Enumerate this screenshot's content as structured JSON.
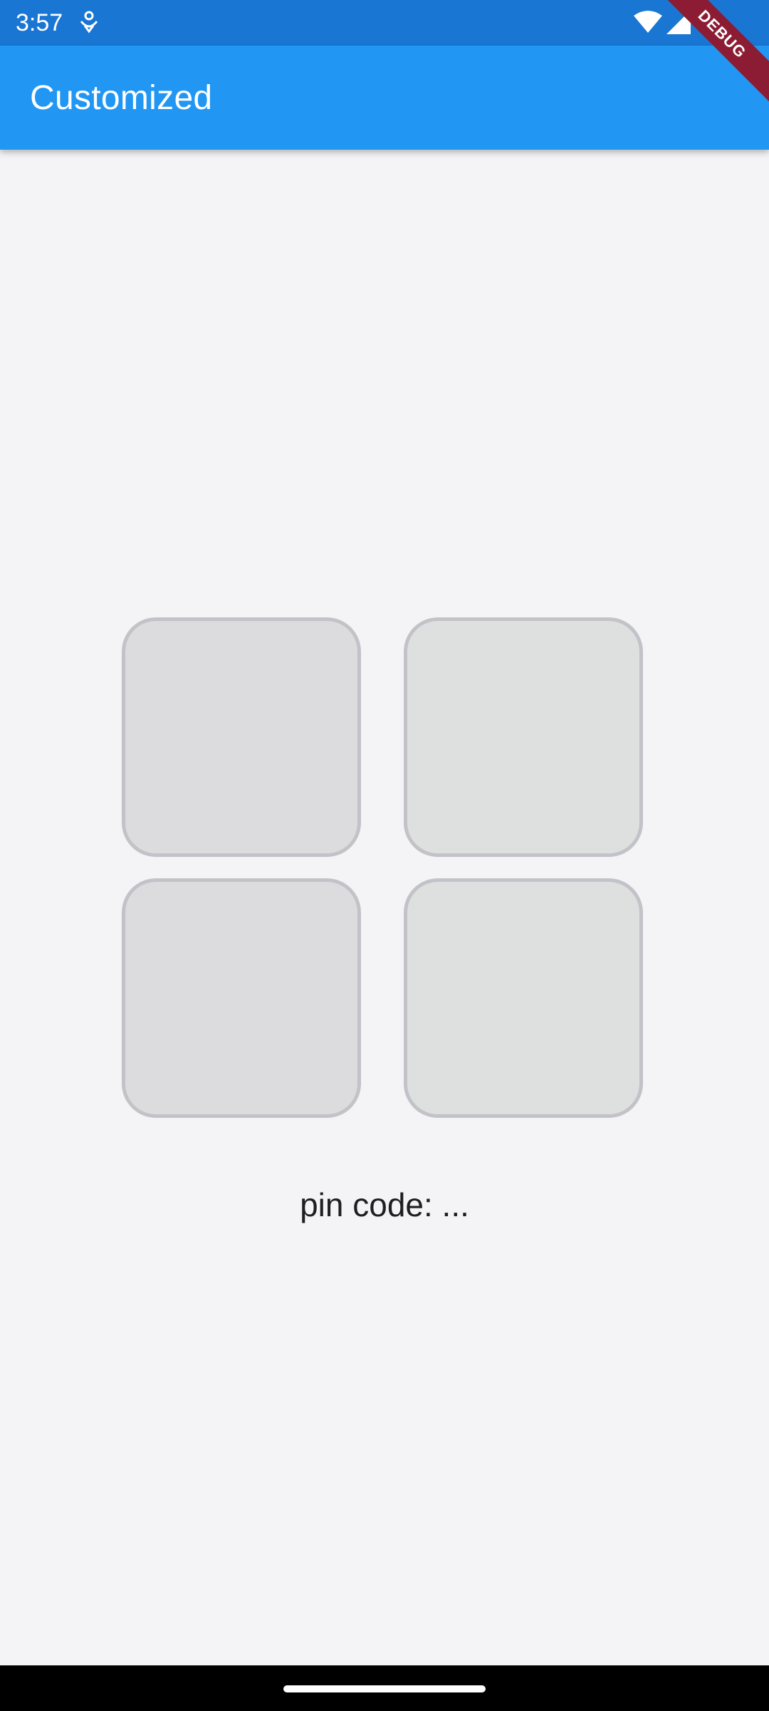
{
  "status_bar": {
    "time": "3:57",
    "icons": [
      "notification-icon",
      "wifi-icon",
      "cell-signal-icon"
    ]
  },
  "app_bar": {
    "title": "Customized",
    "debug_banner": "DEBUG"
  },
  "pin_grid": {
    "tiles": [
      {
        "name": "pin-tile-1"
      },
      {
        "name": "pin-tile-2"
      },
      {
        "name": "pin-tile-3"
      },
      {
        "name": "pin-tile-4"
      }
    ]
  },
  "pin_code": {
    "text": "pin code: ..."
  },
  "colors": {
    "status_bar": "#1976d2",
    "app_bar": "#2196f3",
    "background": "#f4f4f6",
    "tile_fill": "#dcdcdf",
    "tile_border": "#c2c2c8",
    "debug_ribbon": "#8b1c34"
  }
}
